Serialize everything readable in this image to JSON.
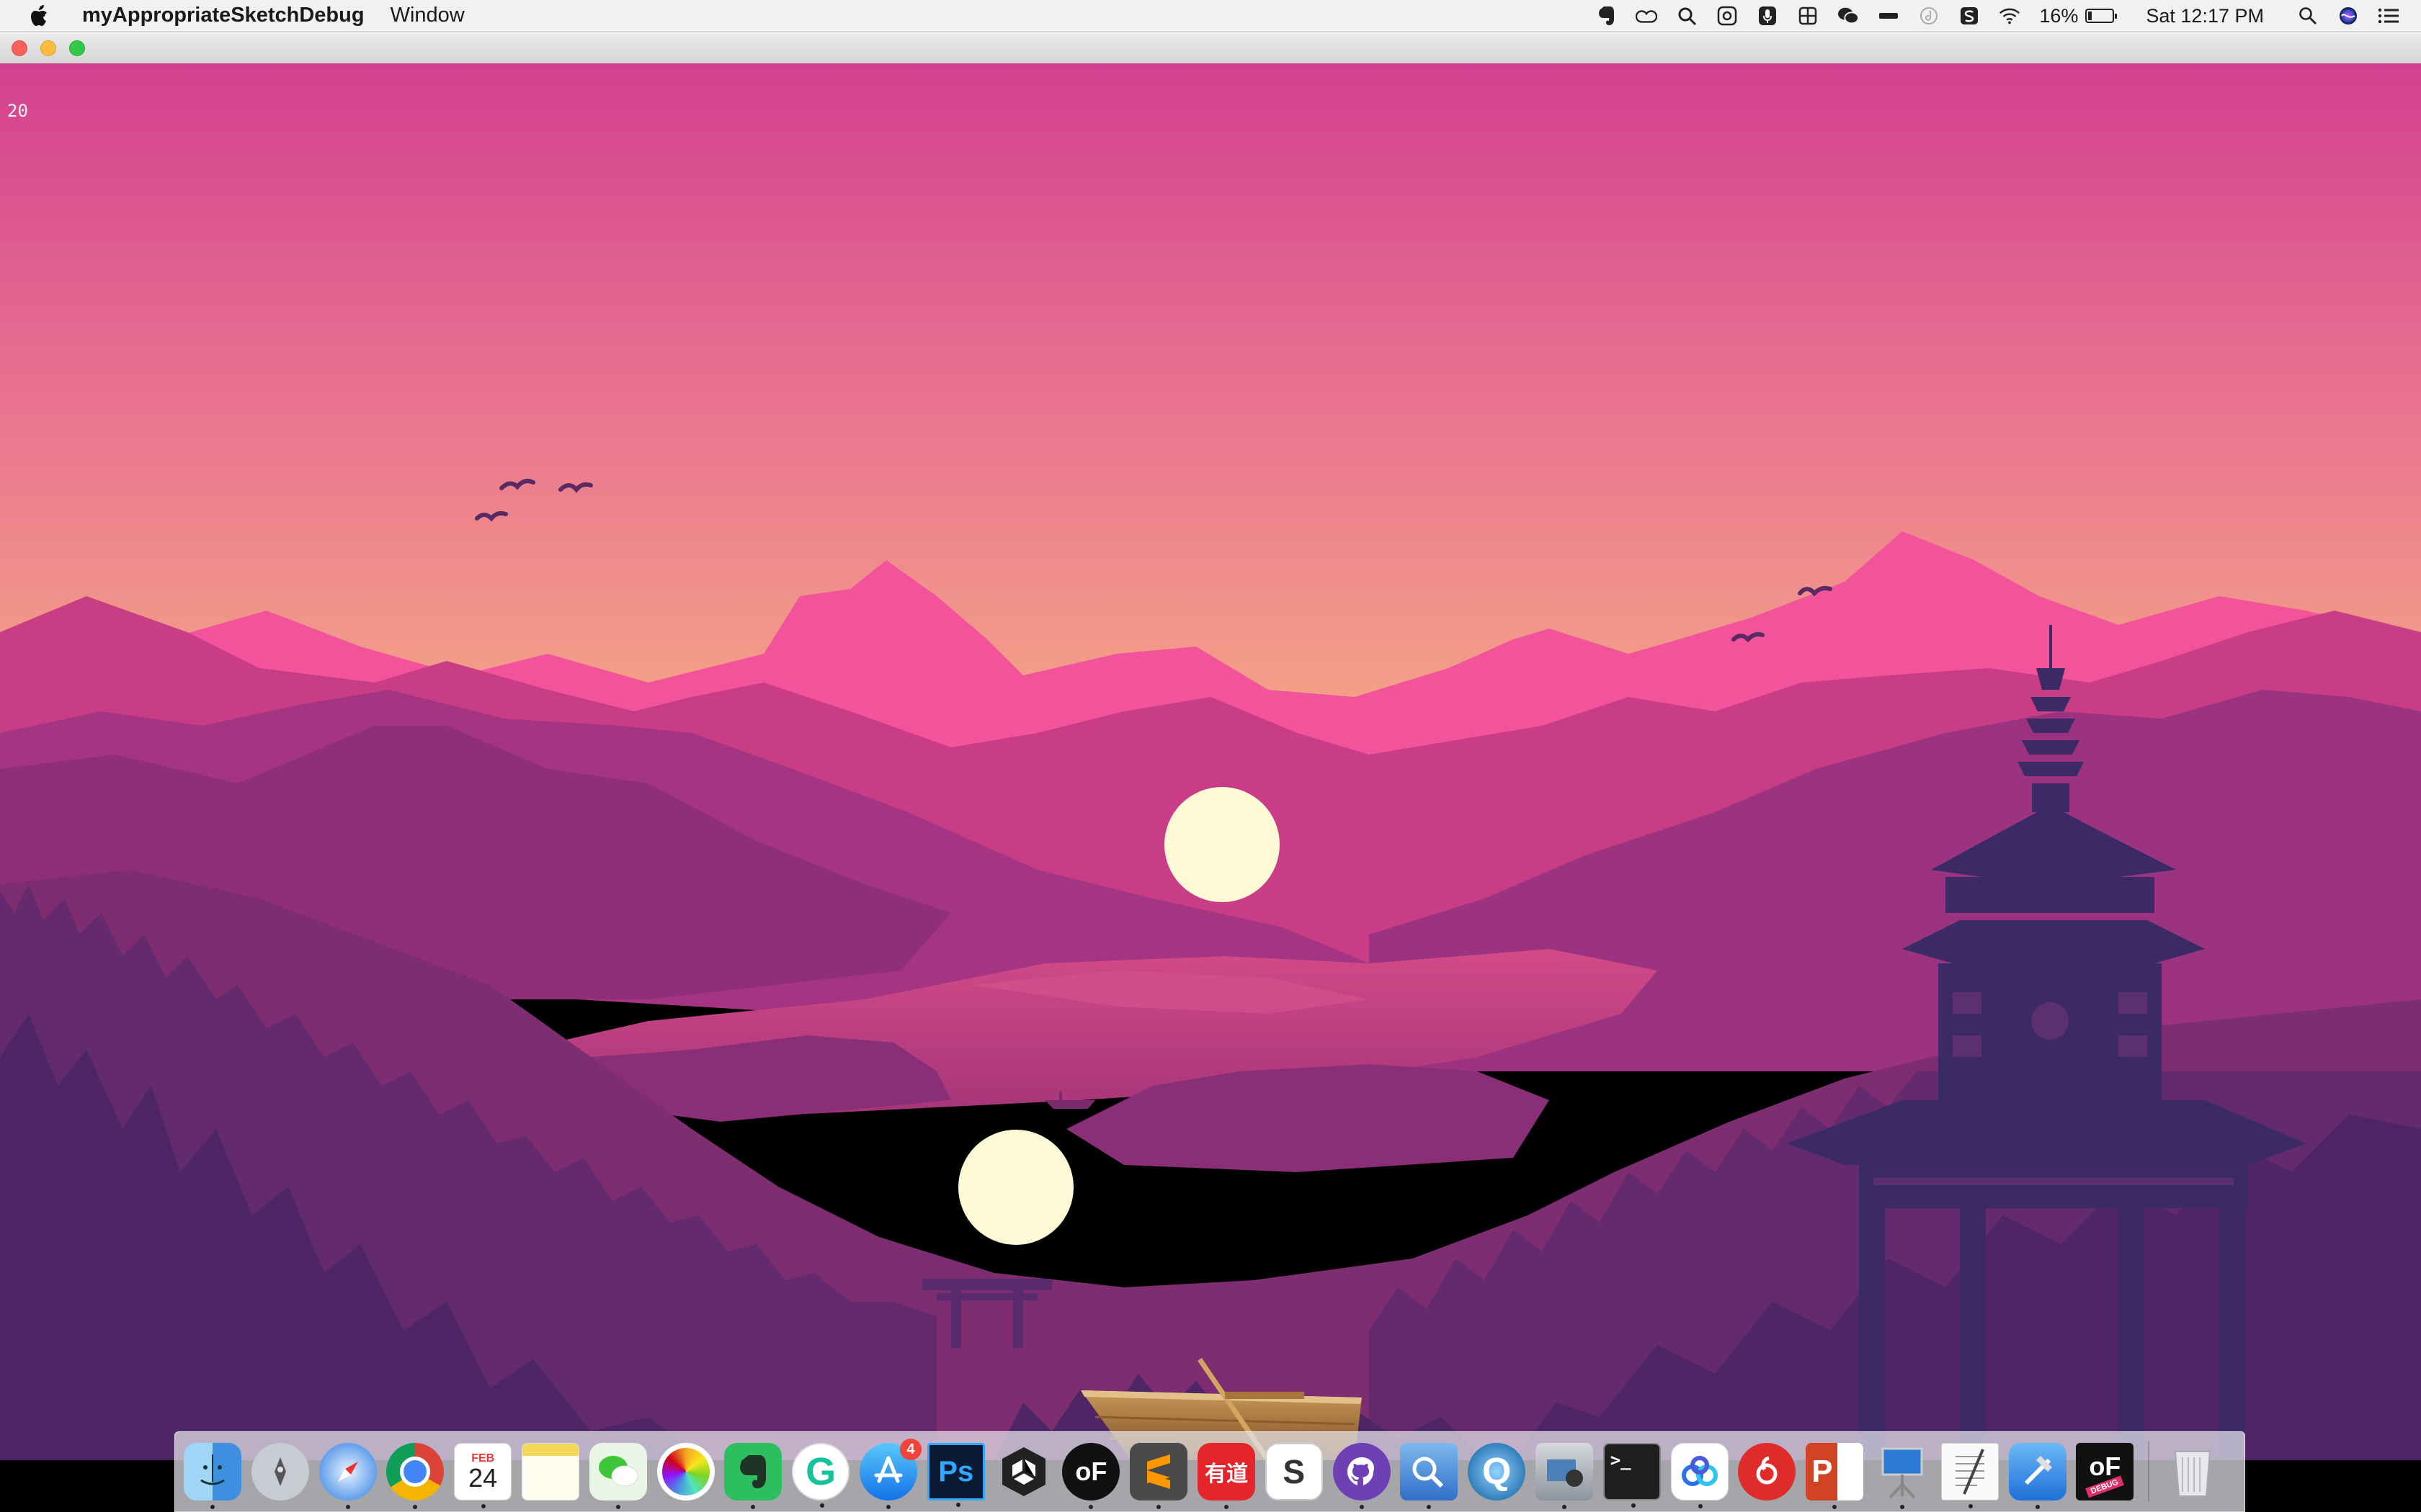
{
  "menubar": {
    "app_name": "myAppropriateSketchDebug",
    "menus": [
      "Window"
    ],
    "status": {
      "battery_percent": "16%",
      "battery_level": 0.16,
      "clock": "Sat 12:17 PM"
    },
    "status_icons": [
      "evernote-icon",
      "creative-cloud-icon",
      "magnifier-tool-icon",
      "grammar-icon",
      "microphone-icon",
      "grid-icon",
      "wechat-icon",
      "battery-strip-icon",
      "circle-icon",
      "sketch-s-icon",
      "wifi-icon",
      "battery-icon",
      "spotlight-search-icon",
      "siri-icon",
      "notification-center-icon"
    ]
  },
  "window": {
    "frame_counter": "20"
  },
  "scene": {
    "colors": {
      "sky_top": "#d2408f",
      "sky_bottom": "#f4a585",
      "far_mountains": "#f25597",
      "mid_mountains": "#c3397f",
      "lake": "#c7407f",
      "near_hills": "#86316f",
      "forest": "#5f2a6b",
      "pagoda": "#3b2a66",
      "moon": "#fefad5"
    },
    "balls": 2
  },
  "dock": {
    "apps": [
      {
        "name": "Finder",
        "icon": "finder-icon"
      },
      {
        "name": "Launchpad",
        "icon": "launchpad-icon"
      },
      {
        "name": "Safari",
        "icon": "safari-icon"
      },
      {
        "name": "Chrome",
        "icon": "chrome-icon"
      },
      {
        "name": "Calendar",
        "icon": "calendar-icon",
        "month": "FEB",
        "day": "24"
      },
      {
        "name": "Notes",
        "icon": "notes-icon"
      },
      {
        "name": "WeChat",
        "icon": "wechat-icon"
      },
      {
        "name": "Photos",
        "icon": "photos-icon"
      },
      {
        "name": "Evernote",
        "icon": "evernote-icon"
      },
      {
        "name": "Grammarly",
        "icon": "grammarly-icon",
        "glyph": "G"
      },
      {
        "name": "App Store",
        "icon": "app-store-icon",
        "badge": "4"
      },
      {
        "name": "Photoshop",
        "icon": "photoshop-icon",
        "glyph": "Ps"
      },
      {
        "name": "Unity",
        "icon": "unity-icon"
      },
      {
        "name": "openFrameworks",
        "icon": "openframeworks-icon",
        "glyph": "oF"
      },
      {
        "name": "Sublime Text",
        "icon": "sublime-icon"
      },
      {
        "name": "Youdao Dictionary",
        "icon": "youdao-icon",
        "glyph": "有道"
      },
      {
        "name": "Slack",
        "icon": "slack-icon",
        "glyph": "S"
      },
      {
        "name": "GitHub Desktop",
        "icon": "github-icon"
      },
      {
        "name": "Preview",
        "icon": "preview-icon"
      },
      {
        "name": "QuickTime",
        "icon": "quicktime-icon",
        "glyph": "Q"
      },
      {
        "name": "Image Capture",
        "icon": "image-capture-icon"
      },
      {
        "name": "Terminal",
        "icon": "terminal-icon",
        "glyph": ">_"
      },
      {
        "name": "Baidu Netdisk",
        "icon": "baidu-cloud-icon"
      },
      {
        "name": "NetEase Music",
        "icon": "netease-music-icon"
      },
      {
        "name": "PowerPoint",
        "icon": "powerpoint-icon",
        "glyph": "P"
      },
      {
        "name": "Keynote",
        "icon": "keynote-icon"
      },
      {
        "name": "TextEdit",
        "icon": "textedit-icon"
      },
      {
        "name": "Xcode",
        "icon": "xcode-icon"
      },
      {
        "name": "oF Debug",
        "icon": "of-debug-icon",
        "glyph": "oF",
        "label": "DEBUG"
      }
    ],
    "trash": {
      "name": "Trash",
      "icon": "trash-icon"
    }
  }
}
